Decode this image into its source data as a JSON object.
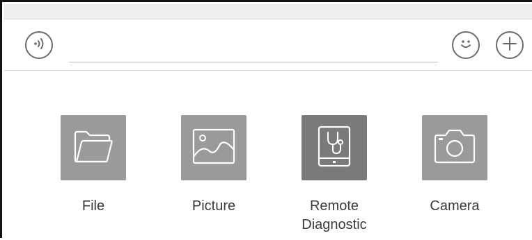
{
  "input_bar": {
    "voice_icon": "voice-wave-icon",
    "message_value": "",
    "emoji_icon": "smiley-face-icon",
    "plus_icon": "plus-icon"
  },
  "attachments": {
    "items": [
      {
        "label": "File",
        "icon": "folder-icon",
        "color": "#9a9a9a"
      },
      {
        "label": "Picture",
        "icon": "image-icon",
        "color": "#9a9a9a"
      },
      {
        "label": "Remote\nDiagnostic",
        "icon": "tablet-stethoscope-icon",
        "color": "#7a7a7a"
      },
      {
        "label": "Camera",
        "icon": "camera-icon",
        "color": "#9a9a9a"
      }
    ]
  }
}
